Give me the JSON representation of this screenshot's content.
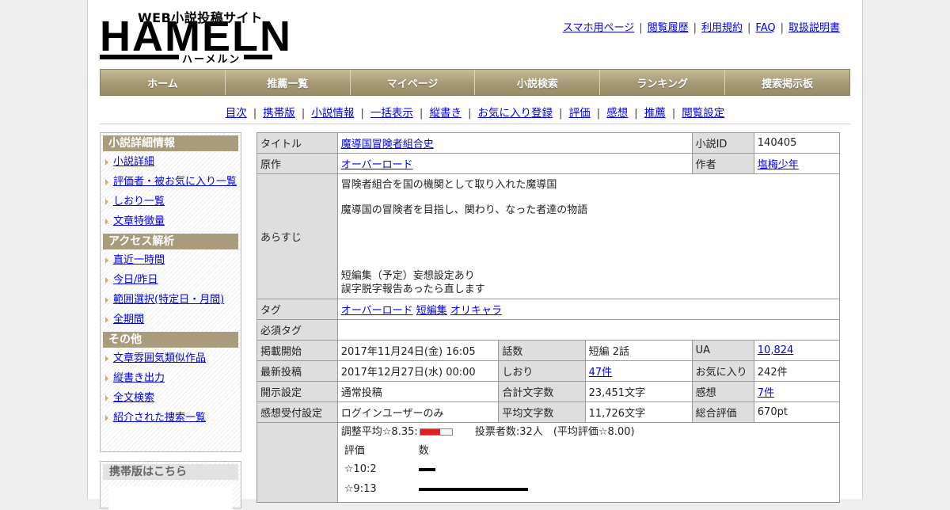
{
  "logo": {
    "tagline": "WEB小説投稿サイト",
    "wordmark": "HAMELN",
    "kana": "ハーメルン"
  },
  "top_links": [
    "スマホ用ページ",
    "閲覧履歴",
    "利用規約",
    "FAQ",
    "取扱説明書"
  ],
  "main_nav": [
    "ホーム",
    "推薦一覧",
    "マイページ",
    "小説検索",
    "ランキング",
    "捜索掲示板"
  ],
  "sub_nav": [
    "目次",
    "携帯版",
    "小説情報",
    "一括表示",
    "縦書き",
    "お気に入り登録",
    "評価",
    "感想",
    "推薦",
    "閲覧設定"
  ],
  "sidebar": {
    "sections": [
      {
        "title": "小説詳細情報",
        "items": [
          "小説詳細",
          "評価者・被お気に入り一覧",
          "しおり一覧",
          "文章特徴量"
        ]
      },
      {
        "title": "アクセス解析",
        "items": [
          "直近一時間",
          "今日/昨日",
          "範囲選択(特定日・月間)",
          "全期間"
        ]
      },
      {
        "title": "その他",
        "items": [
          "文章雰囲気類似作品",
          "縦書き出力",
          "全文検索",
          "紹介された捜索一覧"
        ]
      }
    ],
    "mobile_title": "携帯版はこちら"
  },
  "info": {
    "title_label": "タイトル",
    "title_value": "魔導国冒険者組合史",
    "novel_id_label": "小説ID",
    "novel_id_value": "140405",
    "original_label": "原作",
    "original_value": "オーバーロード",
    "author_label": "作者",
    "author_value": "塩梅少年",
    "synopsis_label": "あらすじ",
    "synopsis_lines": [
      "冒険者組合を国の機関として取り入れた魔導国",
      "魔導国の冒険者を目指し、関わり、なった者達の物語",
      "短編集（予定）妄想設定あり",
      "誤字脱字報告あったら直します"
    ],
    "tags_label": "タグ",
    "tags": [
      "オーバーロード",
      "短編集",
      "オリキャラ"
    ],
    "required_tags_label": "必須タグ",
    "required_tags_value": "",
    "published_label": "掲載開始",
    "published_value": "2017年11月24日(金) 16:05",
    "episodes_label": "話数",
    "episodes_value": "短編 2話",
    "ua_label": "UA",
    "ua_value": "10,824",
    "latest_label": "最新投稿",
    "latest_value": "2017年12月27日(水) 00:00",
    "bookmark_label": "しおり",
    "bookmark_value": "47件",
    "favorites_label": "お気に入り",
    "favorites_value": "242件",
    "visibility_label": "開示設定",
    "visibility_value": "通常投稿",
    "total_chars_label": "合計文字数",
    "total_chars_value": "23,451文字",
    "reviews_label": "感想",
    "reviews_value": "7件",
    "review_accept_label": "感想受付設定",
    "review_accept_value": "ログインユーザーのみ",
    "avg_chars_label": "平均文字数",
    "avg_chars_value": "11,726文字",
    "overall_label": "総合評価",
    "overall_value": "670pt",
    "rating": {
      "adjusted_text": "調整平均☆8.35:",
      "adjusted_fraction": 0.835,
      "votes_text": "投票者数:32人　(平均評価☆8.00)",
      "col_rating": "評価",
      "col_count": "数",
      "rows": [
        {
          "label": "☆10:2",
          "count": 2
        },
        {
          "label": "☆9:13",
          "count": 13
        }
      ]
    }
  }
}
